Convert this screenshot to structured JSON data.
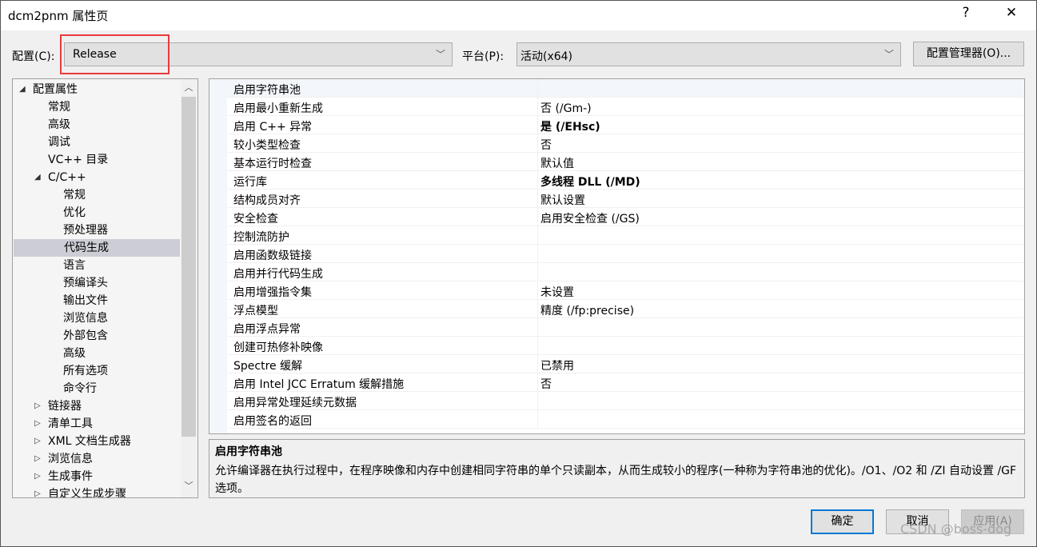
{
  "window": {
    "title": "dcm2pnm 属性页",
    "help": "?",
    "close": "✕"
  },
  "toolbar": {
    "config_label": "配置(C):",
    "config_value": "Release",
    "platform_label": "平台(P):",
    "platform_value": "活动(x64)",
    "config_manager": "配置管理器(O)..."
  },
  "tree": [
    {
      "label": "配置属性",
      "level": 0,
      "expander": "expanded"
    },
    {
      "label": "常规",
      "level": 1
    },
    {
      "label": "高级",
      "level": 1
    },
    {
      "label": "调试",
      "level": 1
    },
    {
      "label": "VC++ 目录",
      "level": 1
    },
    {
      "label": "C/C++",
      "level": 1,
      "expander": "expanded"
    },
    {
      "label": "常规",
      "level": 2
    },
    {
      "label": "优化",
      "level": 2
    },
    {
      "label": "预处理器",
      "level": 2
    },
    {
      "label": "代码生成",
      "level": 2,
      "selected": true
    },
    {
      "label": "语言",
      "level": 2
    },
    {
      "label": "预编译头",
      "level": 2
    },
    {
      "label": "输出文件",
      "level": 2
    },
    {
      "label": "浏览信息",
      "level": 2
    },
    {
      "label": "外部包含",
      "level": 2
    },
    {
      "label": "高级",
      "level": 2
    },
    {
      "label": "所有选项",
      "level": 2
    },
    {
      "label": "命令行",
      "level": 2
    },
    {
      "label": "链接器",
      "level": 1,
      "expander": "collapsed"
    },
    {
      "label": "清单工具",
      "level": 1,
      "expander": "collapsed"
    },
    {
      "label": "XML 文档生成器",
      "level": 1,
      "expander": "collapsed"
    },
    {
      "label": "浏览信息",
      "level": 1,
      "expander": "collapsed"
    },
    {
      "label": "生成事件",
      "level": 1,
      "expander": "collapsed"
    },
    {
      "label": "自定义生成步骤",
      "level": 1,
      "expander": "collapsed"
    }
  ],
  "properties": [
    {
      "name": "启用字符串池",
      "value": ""
    },
    {
      "name": "启用最小重新生成",
      "value": "否 (/Gm-)"
    },
    {
      "name": "启用 C++ 异常",
      "value": "是 (/EHsc)",
      "bold": true
    },
    {
      "name": "较小类型检查",
      "value": "否"
    },
    {
      "name": "基本运行时检查",
      "value": "默认值"
    },
    {
      "name": "运行库",
      "value": "多线程 DLL (/MD)",
      "bold": true
    },
    {
      "name": "结构成员对齐",
      "value": "默认设置"
    },
    {
      "name": "安全检查",
      "value": "启用安全检查 (/GS)"
    },
    {
      "name": "控制流防护",
      "value": ""
    },
    {
      "name": "启用函数级链接",
      "value": ""
    },
    {
      "name": "启用并行代码生成",
      "value": ""
    },
    {
      "name": "启用增强指令集",
      "value": "未设置"
    },
    {
      "name": "浮点模型",
      "value": "精度 (/fp:precise)"
    },
    {
      "name": "启用浮点异常",
      "value": ""
    },
    {
      "name": "创建可热修补映像",
      "value": ""
    },
    {
      "name": "Spectre 缓解",
      "value": "已禁用"
    },
    {
      "name": "启用 Intel JCC Erratum 缓解措施",
      "value": "否"
    },
    {
      "name": "启用异常处理延续元数据",
      "value": ""
    },
    {
      "name": "启用签名的返回",
      "value": ""
    }
  ],
  "description": {
    "title": "启用字符串池",
    "text": "允许编译器在执行过程中，在程序映像和内存中创建相同字符串的单个只读副本，从而生成较小的程序(一种称为字符串池的优化)。/O1、/O2 和 /ZI 自动设置 /GF 选项。"
  },
  "buttons": {
    "ok": "确定",
    "cancel": "取消",
    "apply": "应用(A)"
  },
  "watermark": "CSDN @boss-dog",
  "colors": {
    "highlight": "#ea3a3a",
    "focus": "#0078d7",
    "selection": "#cdcdd6"
  }
}
